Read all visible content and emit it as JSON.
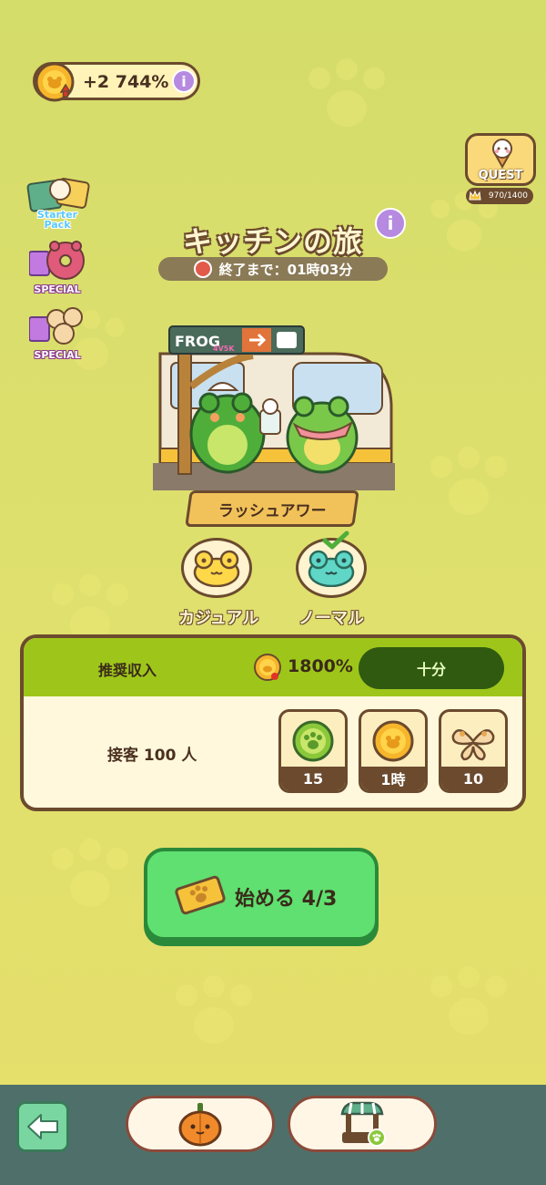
{
  "bonus": {
    "value": "+2 744%",
    "info": "i"
  },
  "quest": {
    "label": "QUEST",
    "progress": "970/1400"
  },
  "promos": [
    {
      "label": "Starter\nPack"
    },
    {
      "label": "SPECIAL"
    },
    {
      "label": "SPECIAL"
    }
  ],
  "event": {
    "title": "キッチンの旅",
    "info": "i",
    "timer": "終了まで：01時03分",
    "stage": "ラッシュアワー",
    "sign_text": "FROG",
    "sign_sub": "4V5K"
  },
  "difficulty": [
    {
      "label": "カジュアル",
      "color": "#ffd84a"
    },
    {
      "label": "ノーマル",
      "color": "#5fd6c6"
    }
  ],
  "panel": {
    "recommended_label": "推奨収入",
    "recommended_value": "1800%",
    "status": "十分",
    "task": "接客 100 人",
    "rewards": [
      {
        "icon": "frog-paw-coin-icon",
        "value": "15"
      },
      {
        "icon": "gold-coin-icon",
        "value": "1時"
      },
      {
        "icon": "butterfly-cookie-icon",
        "value": "10"
      }
    ]
  },
  "start": {
    "label": "始める 4/3"
  },
  "colors": {
    "accent_green": "#5fe070",
    "panel_head": "#9ec61a",
    "bottom_bar": "#4f706a"
  }
}
